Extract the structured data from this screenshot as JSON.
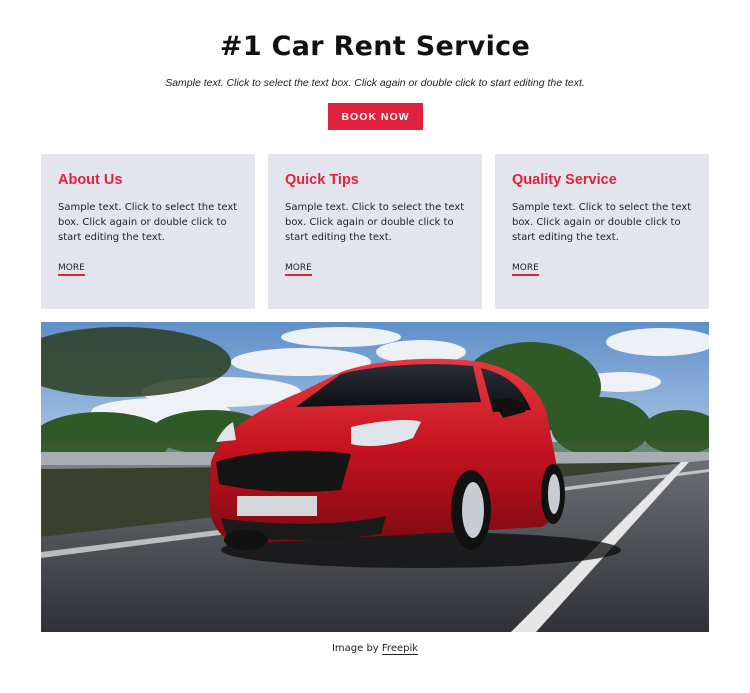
{
  "header": {
    "title": "#1 Car Rent Service",
    "subtitle": "Sample text. Click to select the text box. Click again or double click to start editing the text.",
    "cta_label": "BOOK NOW"
  },
  "cards": [
    {
      "title": "About Us",
      "text": "Sample text. Click to select the text box. Click again or double click to start editing the text.",
      "more": "MORE"
    },
    {
      "title": "Quick Tips",
      "text": "Sample text. Click to select the text box. Click again or double click to start editing the text.",
      "more": "MORE"
    },
    {
      "title": "Quality Service",
      "text": "Sample text. Click to select the text box. Click again or double click to start editing the text.",
      "more": "MORE"
    }
  ],
  "footer": {
    "credit_prefix": "Image by",
    "credit_link": "Freepik"
  },
  "colors": {
    "accent": "#e0223f",
    "card_bg": "#e2e6ec"
  }
}
